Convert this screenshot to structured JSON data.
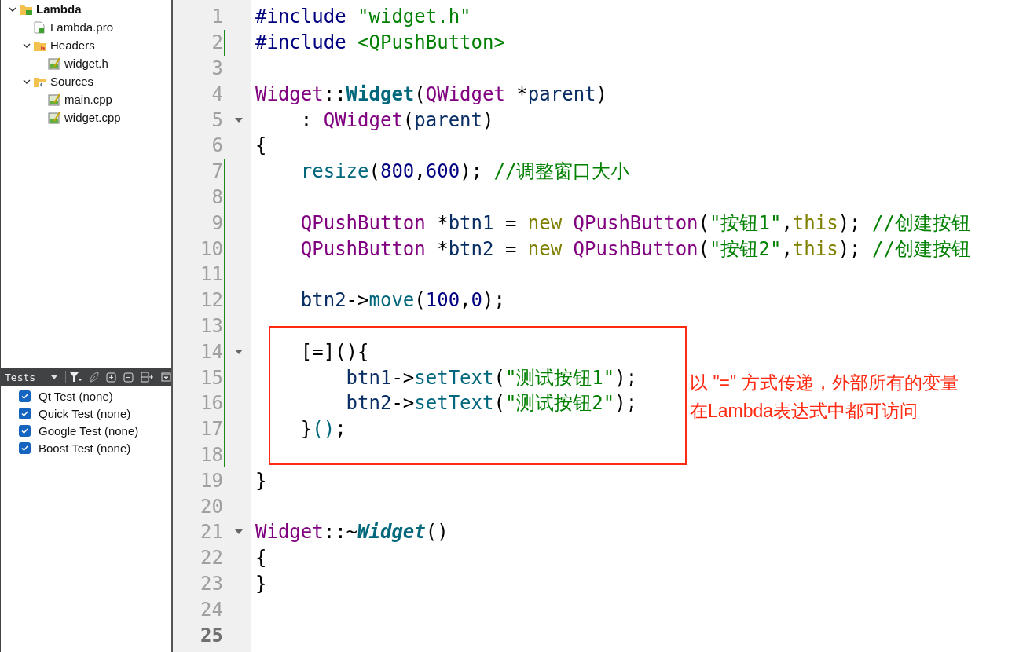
{
  "project_tree": [
    {
      "label": "Lambda",
      "kind": "project",
      "expanded": true,
      "children": [
        {
          "label": "Lambda.pro",
          "kind": "pro-file"
        },
        {
          "label": "Headers",
          "kind": "headers-folder",
          "expanded": true,
          "children": [
            {
              "label": "widget.h",
              "kind": "source-file"
            }
          ]
        },
        {
          "label": "Sources",
          "kind": "sources-folder",
          "expanded": true,
          "children": [
            {
              "label": "main.cpp",
              "kind": "source-file"
            },
            {
              "label": "widget.cpp",
              "kind": "source-file"
            }
          ]
        }
      ]
    }
  ],
  "tests_panel": {
    "selector": "Tests",
    "items": [
      {
        "label": "Qt Test (none)",
        "checked": true
      },
      {
        "label": "Quick Test (none)",
        "checked": true
      },
      {
        "label": "Google Test (none)",
        "checked": true
      },
      {
        "label": "Boost Test (none)",
        "checked": true
      }
    ]
  },
  "editor": {
    "lines": [
      {
        "number": "1",
        "changed": false,
        "foldable": false,
        "current": false,
        "tokens": [
          {
            "text": "#include ",
            "kind": "pre"
          },
          {
            "text": "\"widget.h\"",
            "kind": "str"
          }
        ]
      },
      {
        "number": "2",
        "changed": true,
        "foldable": false,
        "current": false,
        "tokens": [
          {
            "text": "#include ",
            "kind": "pre"
          },
          {
            "text": "<QPushButton>",
            "kind": "str"
          }
        ]
      },
      {
        "number": "3",
        "changed": false,
        "foldable": false,
        "current": false
      },
      {
        "number": "4",
        "changed": false,
        "foldable": false,
        "current": false,
        "tokens": [
          {
            "text": "Widget",
            "kind": "type"
          },
          {
            "text": "::",
            "kind": "p"
          },
          {
            "text": "Widget",
            "kind": "fnb"
          },
          {
            "text": "(",
            "kind": "p"
          },
          {
            "text": "QWidget",
            "kind": "type"
          },
          {
            "text": " *",
            "kind": "p"
          },
          {
            "text": "parent",
            "kind": "id"
          },
          {
            "text": ")",
            "kind": "p"
          }
        ]
      },
      {
        "number": "5",
        "changed": false,
        "foldable": true,
        "current": false,
        "tokens": [
          {
            "text": "    : ",
            "kind": "p"
          },
          {
            "text": "QWidget",
            "kind": "type"
          },
          {
            "text": "(",
            "kind": "p"
          },
          {
            "text": "parent",
            "kind": "id"
          },
          {
            "text": ")",
            "kind": "p"
          }
        ]
      },
      {
        "number": "6",
        "changed": false,
        "foldable": false,
        "current": false,
        "tokens": [
          {
            "text": "{",
            "kind": "p"
          }
        ]
      },
      {
        "number": "7",
        "changed": true,
        "foldable": false,
        "current": false,
        "tokens": [
          {
            "text": "    resize",
            "kind": "fn"
          },
          {
            "text": "(",
            "kind": "p"
          },
          {
            "text": "800",
            "kind": "num"
          },
          {
            "text": ",",
            "kind": "p"
          },
          {
            "text": "600",
            "kind": "num"
          },
          {
            "text": "); ",
            "kind": "p"
          },
          {
            "text": "//调整窗口大小",
            "kind": "cmt"
          }
        ]
      },
      {
        "number": "8",
        "changed": true,
        "foldable": false,
        "current": false
      },
      {
        "number": "9",
        "changed": true,
        "foldable": false,
        "current": false,
        "tokens": [
          {
            "text": "    QPushButton",
            "kind": "type"
          },
          {
            "text": " *",
            "kind": "p"
          },
          {
            "text": "btn1",
            "kind": "id"
          },
          {
            "text": " = ",
            "kind": "p"
          },
          {
            "text": "new ",
            "kind": "kw"
          },
          {
            "text": "QPushButton",
            "kind": "type"
          },
          {
            "text": "(",
            "kind": "p"
          },
          {
            "text": "\"按钮1\"",
            "kind": "str"
          },
          {
            "text": ",",
            "kind": "p"
          },
          {
            "text": "this",
            "kind": "kw"
          },
          {
            "text": "); ",
            "kind": "p"
          },
          {
            "text": "//创建按钮",
            "kind": "cmt"
          }
        ]
      },
      {
        "number": "10",
        "changed": true,
        "foldable": false,
        "current": false,
        "tokens": [
          {
            "text": "    QPushButton",
            "kind": "type"
          },
          {
            "text": " *",
            "kind": "p"
          },
          {
            "text": "btn2",
            "kind": "id"
          },
          {
            "text": " = ",
            "kind": "p"
          },
          {
            "text": "new ",
            "kind": "kw"
          },
          {
            "text": "QPushButton",
            "kind": "type"
          },
          {
            "text": "(",
            "kind": "p"
          },
          {
            "text": "\"按钮2\"",
            "kind": "str"
          },
          {
            "text": ",",
            "kind": "p"
          },
          {
            "text": "this",
            "kind": "kw"
          },
          {
            "text": "); ",
            "kind": "p"
          },
          {
            "text": "//创建按钮",
            "kind": "cmt"
          }
        ]
      },
      {
        "number": "11",
        "changed": true,
        "foldable": false,
        "current": false
      },
      {
        "number": "12",
        "changed": true,
        "foldable": false,
        "current": false,
        "tokens": [
          {
            "text": "    btn2",
            "kind": "id"
          },
          {
            "text": "->",
            "kind": "p"
          },
          {
            "text": "move",
            "kind": "fn"
          },
          {
            "text": "(",
            "kind": "p"
          },
          {
            "text": "100",
            "kind": "num"
          },
          {
            "text": ",",
            "kind": "p"
          },
          {
            "text": "0",
            "kind": "num"
          },
          {
            "text": ");",
            "kind": "p"
          }
        ]
      },
      {
        "number": "13",
        "changed": true,
        "foldable": false,
        "current": false
      },
      {
        "number": "14",
        "changed": true,
        "foldable": true,
        "current": false,
        "tokens": [
          {
            "text": "    [=](){",
            "kind": "p"
          }
        ]
      },
      {
        "number": "15",
        "changed": true,
        "foldable": false,
        "current": false,
        "tokens": [
          {
            "text": "        btn1",
            "kind": "id"
          },
          {
            "text": "->",
            "kind": "p"
          },
          {
            "text": "setText",
            "kind": "fn"
          },
          {
            "text": "(",
            "kind": "p"
          },
          {
            "text": "\"测试按钮1\"",
            "kind": "str"
          },
          {
            "text": ");",
            "kind": "p"
          }
        ]
      },
      {
        "number": "16",
        "changed": true,
        "foldable": false,
        "current": false,
        "tokens": [
          {
            "text": "        btn2",
            "kind": "id"
          },
          {
            "text": "->",
            "kind": "p"
          },
          {
            "text": "setText",
            "kind": "fn"
          },
          {
            "text": "(",
            "kind": "p"
          },
          {
            "text": "\"测试按钮2\"",
            "kind": "str"
          },
          {
            "text": ");",
            "kind": "p"
          }
        ]
      },
      {
        "number": "17",
        "changed": true,
        "foldable": false,
        "current": false,
        "tokens": [
          {
            "text": "    }",
            "kind": "p"
          },
          {
            "text": "()",
            "kind": "fn"
          },
          {
            "text": ";",
            "kind": "p"
          }
        ]
      },
      {
        "number": "18",
        "changed": true,
        "foldable": false,
        "current": false
      },
      {
        "number": "19",
        "changed": false,
        "foldable": false,
        "current": false,
        "tokens": [
          {
            "text": "}",
            "kind": "p"
          }
        ]
      },
      {
        "number": "20",
        "changed": false,
        "foldable": false,
        "current": false
      },
      {
        "number": "21",
        "changed": false,
        "foldable": true,
        "current": false,
        "tokens": [
          {
            "text": "Widget",
            "kind": "type"
          },
          {
            "text": "::~",
            "kind": "p"
          },
          {
            "text": "Widget",
            "kind": "fni"
          },
          {
            "text": "()",
            "kind": "p"
          }
        ]
      },
      {
        "number": "22",
        "changed": false,
        "foldable": false,
        "current": false,
        "tokens": [
          {
            "text": "{",
            "kind": "p"
          }
        ]
      },
      {
        "number": "23",
        "changed": false,
        "foldable": false,
        "current": false,
        "tokens": [
          {
            "text": "}",
            "kind": "p"
          }
        ]
      },
      {
        "number": "24",
        "changed": false,
        "foldable": false,
        "current": false
      },
      {
        "number": "25",
        "changed": false,
        "foldable": false,
        "current": true
      }
    ]
  },
  "annotation": {
    "note": "以 \"=\" 方式传递，外部所有的变量在Lambda表达式中都可访问"
  }
}
